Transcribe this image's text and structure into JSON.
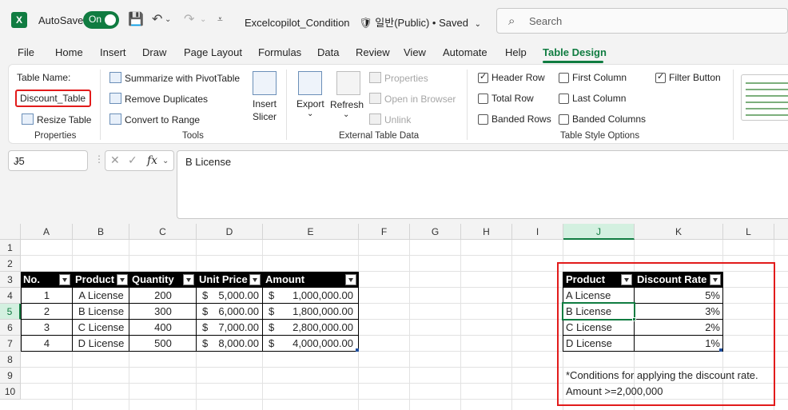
{
  "titlebar": {
    "autosave_label": "AutoSave",
    "toggle_label": "On",
    "doc_title": "Excelcopilot_Condition",
    "sensitivity": "일반(Public)",
    "saved": "• Saved",
    "search_placeholder": "Search"
  },
  "tabs": [
    "File",
    "Home",
    "Insert",
    "Draw",
    "Page Layout",
    "Formulas",
    "Data",
    "Review",
    "View",
    "Automate",
    "Help",
    "Table Design"
  ],
  "ribbon": {
    "properties": {
      "table_name_label": "Table Name:",
      "table_name_value": "Discount_Table",
      "resize": "Resize Table",
      "group": "Properties"
    },
    "tools": {
      "summarize": "Summarize with PivotTable",
      "remove_dup": "Remove Duplicates",
      "convert": "Convert to Range",
      "insert_slicer": [
        "Insert",
        "Slicer"
      ],
      "group": "Tools"
    },
    "external": {
      "export": "Export",
      "refresh": "Refresh",
      "properties": "Properties",
      "open_browser": "Open in Browser",
      "unlink": "Unlink",
      "group": "External Table Data"
    },
    "style_options": {
      "header_row": "Header Row",
      "total_row": "Total Row",
      "banded_rows": "Banded Rows",
      "first_column": "First Column",
      "last_column": "Last Column",
      "banded_columns": "Banded Columns",
      "filter_button": "Filter Button",
      "group": "Table Style Options"
    }
  },
  "formula_bar": {
    "name_box": "J5",
    "formula": "B License"
  },
  "columns": [
    "A",
    "B",
    "C",
    "D",
    "E",
    "F",
    "G",
    "H",
    "I",
    "J",
    "K",
    "L"
  ],
  "rows": [
    "1",
    "2",
    "3",
    "4",
    "5",
    "6",
    "7",
    "8",
    "9",
    "10"
  ],
  "table1": {
    "headers": [
      "No.",
      "Product",
      "Quantity",
      "Unit Price",
      "Amount"
    ],
    "rows": [
      {
        "no": "1",
        "product": "A License",
        "qty": "200",
        "price_sym": "$",
        "price": "5,000.00",
        "amt_sym": "$",
        "amount": "1,000,000.00"
      },
      {
        "no": "2",
        "product": "B License",
        "qty": "300",
        "price_sym": "$",
        "price": "6,000.00",
        "amt_sym": "$",
        "amount": "1,800,000.00"
      },
      {
        "no": "3",
        "product": "C License",
        "qty": "400",
        "price_sym": "$",
        "price": "7,000.00",
        "amt_sym": "$",
        "amount": "2,800,000.00"
      },
      {
        "no": "4",
        "product": "D License",
        "qty": "500",
        "price_sym": "$",
        "price": "8,000.00",
        "amt_sym": "$",
        "amount": "4,000,000.00"
      }
    ]
  },
  "table2": {
    "headers": [
      "Product",
      "Discount Rate"
    ],
    "rows": [
      {
        "product": "A License",
        "rate": "5%"
      },
      {
        "product": "B License",
        "rate": "3%"
      },
      {
        "product": "C License",
        "rate": "2%"
      },
      {
        "product": "D License",
        "rate": "1%"
      }
    ]
  },
  "notes": {
    "line1": "*Conditions for applying the discount rate.",
    "line2": "Amount >=2,000,000"
  },
  "colors": {
    "accent": "#107c41",
    "highlight": "#e21b1b"
  }
}
